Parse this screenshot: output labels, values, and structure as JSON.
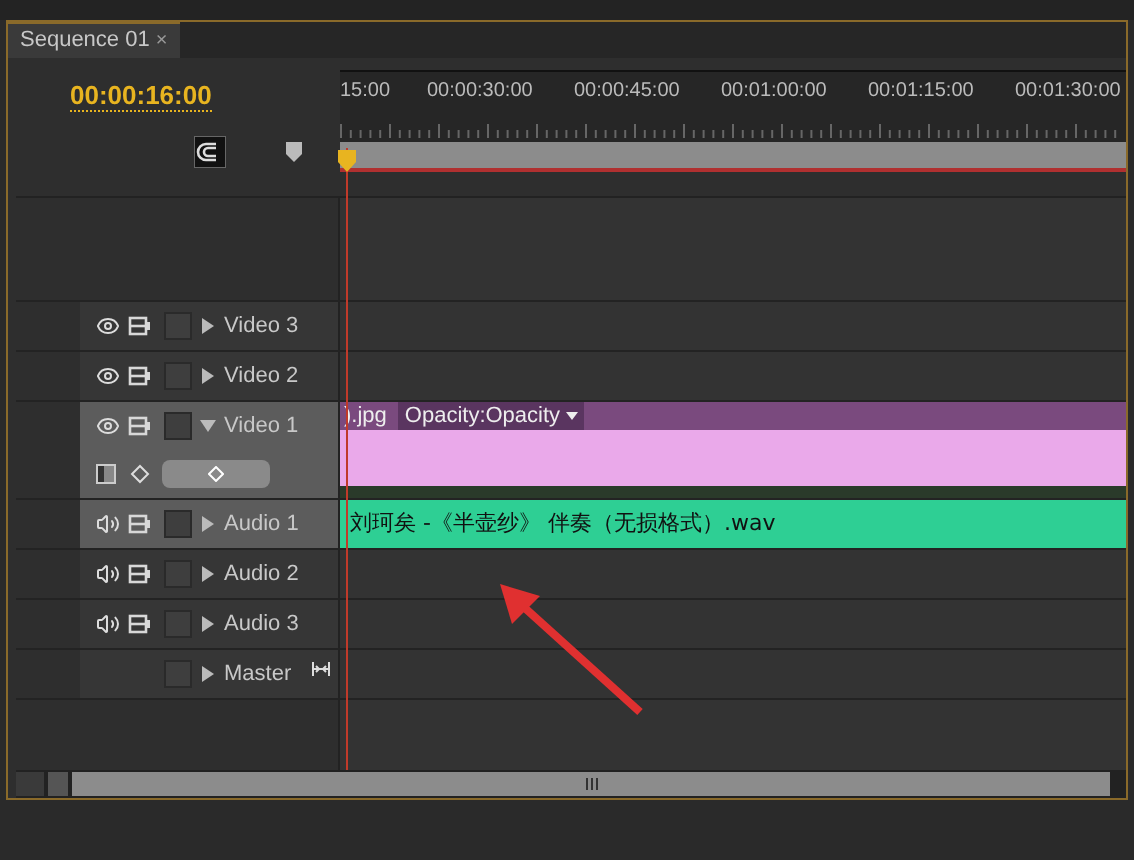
{
  "tab": {
    "label": "Sequence 01",
    "close": "×",
    "selected": true
  },
  "timecode": "00:00:16:00",
  "ruler": {
    "labels": [
      "15:00",
      "00:00:30:00",
      "00:00:45:00",
      "00:01:00:00",
      "00:01:15:00",
      "00:01:30:00"
    ]
  },
  "tracks": [
    {
      "kind": "video",
      "name": "Video 3",
      "expanded": false,
      "targeted": false
    },
    {
      "kind": "video",
      "name": "Video 2",
      "expanded": false,
      "targeted": false
    },
    {
      "kind": "video",
      "name": "Video 1",
      "expanded": true,
      "targeted": true,
      "clip": {
        "name": ").jpg",
        "effect": "Opacity:Opacity",
        "color": "#eaa9ea"
      }
    },
    {
      "kind": "audio",
      "name": "Audio 1",
      "expanded": false,
      "targeted": true,
      "clip": {
        "name": "刘珂矣 -《半壶纱》 伴奏（无损格式）.wav",
        "color": "#2ecf94"
      }
    },
    {
      "kind": "audio",
      "name": "Audio 2",
      "expanded": false,
      "targeted": false
    },
    {
      "kind": "audio",
      "name": "Audio 3",
      "expanded": false,
      "targeted": false
    },
    {
      "kind": "master",
      "name": "Master",
      "expanded": false,
      "targeted": false
    }
  ]
}
